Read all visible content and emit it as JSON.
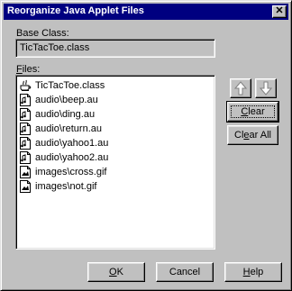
{
  "window": {
    "title": "Reorganize Java Applet Files",
    "close_glyph": "✕"
  },
  "base_class": {
    "label": "Base Class:",
    "value": "TicTacToe.class"
  },
  "files": {
    "label_prefix": "F",
    "label_rest": "iles:",
    "items": [
      {
        "icon": "java-class-icon",
        "name": "TicTacToe.class"
      },
      {
        "icon": "audio-file-icon",
        "name": "audio\\beep.au"
      },
      {
        "icon": "audio-file-icon",
        "name": "audio\\ding.au"
      },
      {
        "icon": "audio-file-icon",
        "name": "audio\\return.au"
      },
      {
        "icon": "audio-file-icon",
        "name": "audio\\yahoo1.au"
      },
      {
        "icon": "audio-file-icon",
        "name": "audio\\yahoo2.au"
      },
      {
        "icon": "image-file-icon",
        "name": "images\\cross.gif"
      },
      {
        "icon": "image-file-icon",
        "name": "images\\not.gif"
      }
    ]
  },
  "side_buttons": {
    "move_up_icon": "arrow-up-icon",
    "move_down_icon": "arrow-down-icon",
    "clear_mnemonic": "C",
    "clear_rest": "lear",
    "clear_all_pre": "Cl",
    "clear_all_mnemonic": "e",
    "clear_all_rest": "ar All"
  },
  "footer": {
    "ok_mnemonic": "O",
    "ok_rest": "K",
    "cancel": "Cancel",
    "help_mnemonic": "H",
    "help_rest": "elp"
  }
}
